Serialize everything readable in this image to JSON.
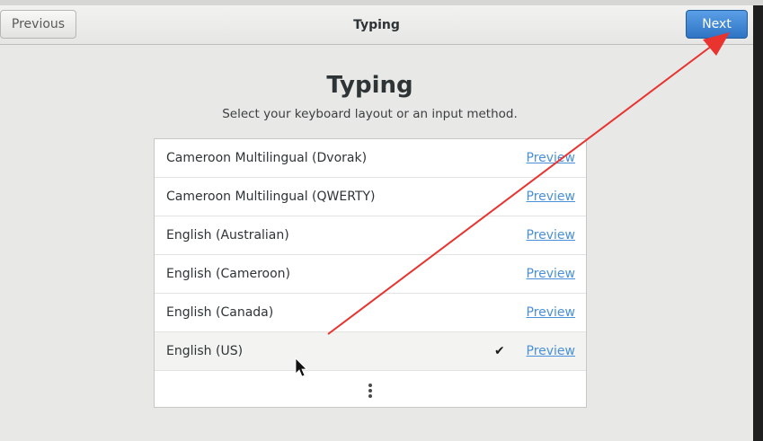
{
  "header": {
    "previous_label": "Previous",
    "title": "Typing",
    "next_label": "Next"
  },
  "page": {
    "title": "Typing",
    "subtitle": "Select your keyboard layout or an input method."
  },
  "layouts": [
    {
      "label": "Cameroon Multilingual (Dvorak)",
      "preview": "Preview",
      "selected": false
    },
    {
      "label": "Cameroon Multilingual (QWERTY)",
      "preview": "Preview",
      "selected": false
    },
    {
      "label": "English (Australian)",
      "preview": "Preview",
      "selected": false
    },
    {
      "label": "English (Cameroon)",
      "preview": "Preview",
      "selected": false
    },
    {
      "label": "English (Canada)",
      "preview": "Preview",
      "selected": false
    },
    {
      "label": "English (US)",
      "preview": "Preview",
      "selected": true
    }
  ],
  "icons": {
    "selected_marker": "checkmark-icon",
    "more": "more-vertical-icon",
    "pointer": "mouse-cursor-icon"
  },
  "colors": {
    "accent_blue": "#3b82d4",
    "link_blue": "#4a90d9",
    "annotation_red": "#e8332f"
  }
}
